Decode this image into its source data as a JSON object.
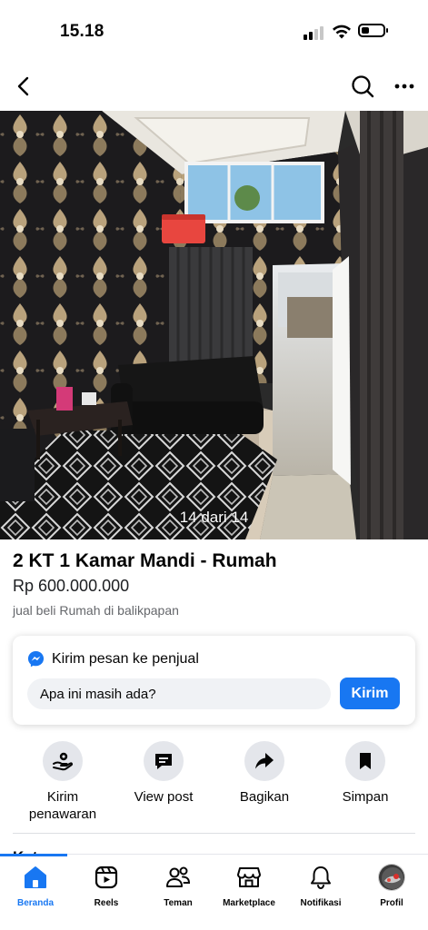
{
  "status_bar": {
    "time": "15.18",
    "signal_bars_on": 2,
    "battery_level_pct": 35
  },
  "top_nav": {
    "back_icon": "chevron-left-icon",
    "search_icon": "search-icon",
    "more_icon": "more-horizontal-icon"
  },
  "photo": {
    "counter": "14 dari 14",
    "current_index": 14,
    "total": 14
  },
  "listing": {
    "title": "2 KT 1 Kamar Mandi - Rumah",
    "price": "Rp 600.000.000",
    "location": "jual beli Rumah di balikpapan"
  },
  "message_card": {
    "heading": "Kirim pesan ke penjual",
    "input_value": "Apa ini masih ada?",
    "send_label": "Kirim"
  },
  "actions": [
    {
      "label": "Kirim penawaran",
      "icon": "offer-hand-icon"
    },
    {
      "label": "View post",
      "icon": "view-post-icon"
    },
    {
      "label": "Bagikan",
      "icon": "share-arrow-icon"
    },
    {
      "label": "Simpan",
      "icon": "bookmark-icon"
    }
  ],
  "peek_text": "Kete",
  "tabs": [
    {
      "label": "Beranda",
      "icon": "home-icon",
      "active": true
    },
    {
      "label": "Reels",
      "icon": "reels-icon",
      "active": false
    },
    {
      "label": "Teman",
      "icon": "friends-icon",
      "active": false
    },
    {
      "label": "Marketplace",
      "icon": "marketplace-icon",
      "active": false
    },
    {
      "label": "Notifikasi",
      "icon": "bell-icon",
      "active": false
    },
    {
      "label": "Profil",
      "icon": "avatar",
      "active": false
    }
  ],
  "colors": {
    "accent": "#1877f2",
    "action_bg": "#e4e6eb",
    "input_bg": "#f0f2f5",
    "secondary_text": "#65676b"
  }
}
